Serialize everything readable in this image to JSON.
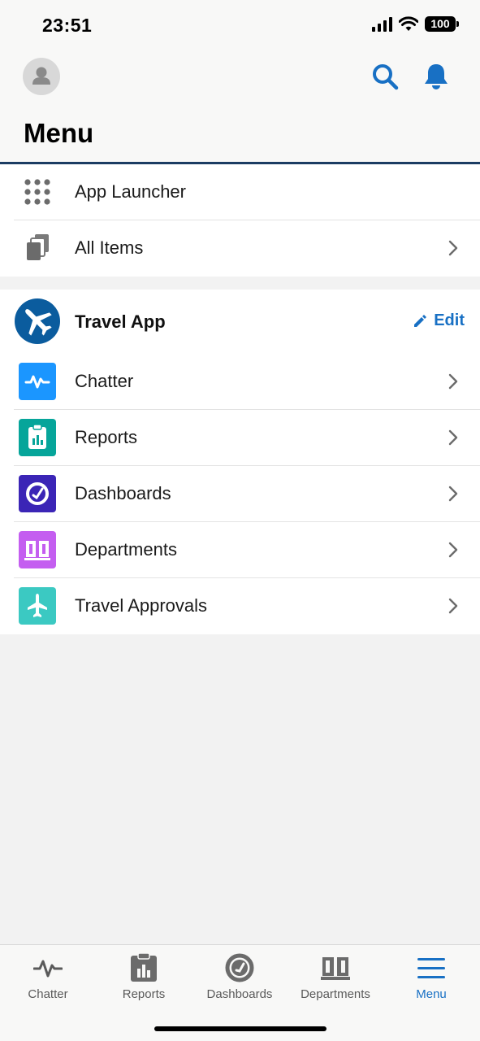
{
  "status": {
    "time": "23:51",
    "battery": "100"
  },
  "header": {
    "title": "Menu"
  },
  "menu": {
    "items": [
      {
        "label": "App Launcher",
        "icon": "app-grid-icon"
      },
      {
        "label": "All Items",
        "icon": "all-items-icon"
      }
    ]
  },
  "app": {
    "name": "Travel App",
    "edit_label": "Edit",
    "items": [
      {
        "label": "Chatter",
        "icon": "chatter-icon",
        "color": "#1b96ff"
      },
      {
        "label": "Reports",
        "icon": "reports-icon",
        "color": "#06a59a"
      },
      {
        "label": "Dashboards",
        "icon": "dashboards-icon",
        "color": "#3b25b6"
      },
      {
        "label": "Departments",
        "icon": "departments-icon",
        "color": "#c45ef0"
      },
      {
        "label": "Travel Approvals",
        "icon": "airplane-icon",
        "color": "#3bc9c2"
      }
    ]
  },
  "tabbar": {
    "tabs": [
      {
        "label": "Chatter",
        "icon": "chatter-icon"
      },
      {
        "label": "Reports",
        "icon": "reports-icon"
      },
      {
        "label": "Dashboards",
        "icon": "dashboards-icon"
      },
      {
        "label": "Departments",
        "icon": "departments-icon"
      },
      {
        "label": "Menu",
        "icon": "menu-icon",
        "active": true
      }
    ]
  },
  "colors": {
    "accent": "#1870c4",
    "header_rule": "#1b3c63"
  }
}
